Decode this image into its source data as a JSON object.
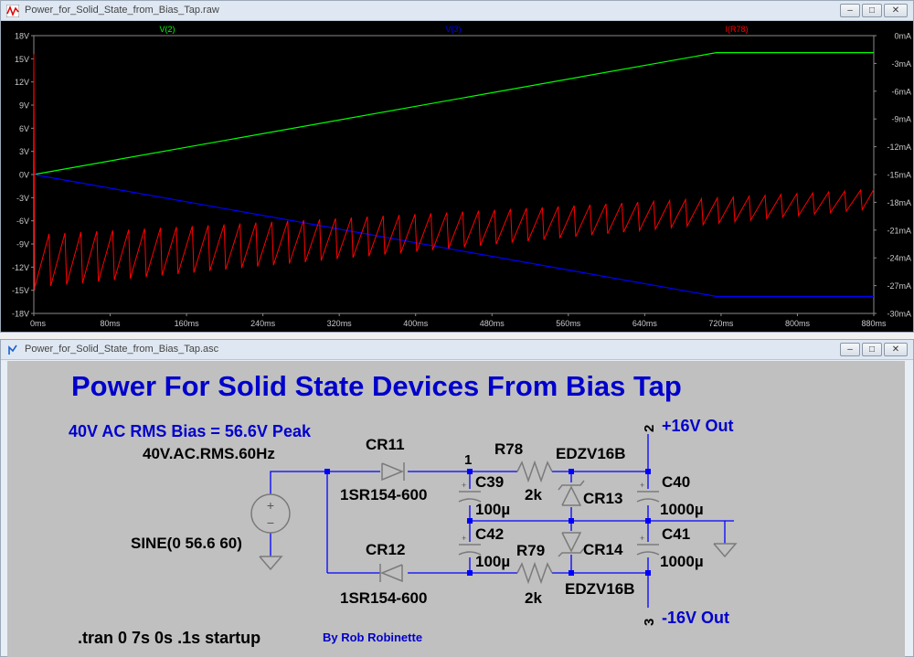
{
  "plot_window": {
    "title": "Power_for_Solid_State_from_Bias_Tap.raw",
    "buttons": [
      "minimize",
      "restore",
      "close"
    ]
  },
  "schematic_window": {
    "title": "Power_for_Solid_State_from_Bias_Tap.asc",
    "buttons": [
      "minimize",
      "restore",
      "close"
    ]
  },
  "chart_data": {
    "type": "line",
    "legend": [
      "V(2)",
      "V(3)",
      "I(R78)"
    ],
    "x_ticks": [
      "0ms",
      "80ms",
      "160ms",
      "240ms",
      "320ms",
      "400ms",
      "480ms",
      "560ms",
      "640ms",
      "720ms",
      "800ms",
      "880ms"
    ],
    "left_ticks": [
      "18V",
      "15V",
      "12V",
      "9V",
      "6V",
      "3V",
      "0V",
      "-3V",
      "-6V",
      "-9V",
      "-12V",
      "-15V",
      "-18V"
    ],
    "right_ticks": [
      "0mA",
      "-3mA",
      "-6mA",
      "-9mA",
      "-12mA",
      "-15mA",
      "-18mA",
      "-21mA",
      "-24mA",
      "-27mA",
      "-30mA"
    ],
    "xlim": [
      0,
      880
    ],
    "ylim_left": [
      -18,
      18
    ],
    "ylim_right": [
      -30,
      0
    ],
    "grid": false,
    "colors": {
      "V(2)": "#00ff00",
      "V(3)": "#0000ff",
      "I(R78)": "#ff0000"
    },
    "series": [
      {
        "name": "V(2)",
        "axis": "left",
        "x": [
          0,
          715,
          880
        ],
        "values": [
          0,
          15.8,
          15.8
        ]
      },
      {
        "name": "V(3)",
        "axis": "left",
        "x": [
          0,
          715,
          880
        ],
        "values": [
          0,
          -15.8,
          -15.8
        ]
      },
      {
        "name": "I(R78)",
        "axis": "right",
        "sawtooth": {
          "period_ms": 16.67,
          "start": [
            -27.2,
            -21.4
          ],
          "end": [
            -18.8,
            -16.6
          ],
          "x_end": 880
        }
      }
    ]
  },
  "schematic": {
    "title": "Power For Solid State Devices From Bias Tap",
    "bias_note": "40V AC RMS Bias = 56.6V Peak",
    "source_label": "40V.AC.RMS.60Hz",
    "source_value": "SINE(0 56.6 60)",
    "directive": ".tran 0 7s 0s .1s startup",
    "author": "By Rob Robinette",
    "parts": {
      "cr11": {
        "ref": "CR11",
        "value": "1SR154-600"
      },
      "cr12": {
        "ref": "CR12",
        "value": "1SR154-600"
      },
      "c39": {
        "ref": "C39",
        "value": "100µ"
      },
      "c42": {
        "ref": "C42",
        "value": "100µ"
      },
      "r78": {
        "ref": "R78",
        "value": "2k"
      },
      "r79": {
        "ref": "R79",
        "value": "2k"
      },
      "cr13": {
        "ref": "CR13",
        "value": "EDZV16B"
      },
      "cr14": {
        "ref": "CR14",
        "value": "EDZV16B"
      },
      "c40": {
        "ref": "C40",
        "value": "1000µ"
      },
      "c41": {
        "ref": "C41",
        "value": "1000µ"
      }
    },
    "nodes": {
      "n1": "1",
      "n2": "2",
      "n3": "3"
    },
    "outputs": {
      "pos": "+16V Out",
      "neg": "-16V Out"
    },
    "colors": {
      "title": "#0000cc",
      "wire": "#0000ff",
      "junction": "#0000ff",
      "text": "#000000",
      "background": "#c0c0c0",
      "component": "#7a7a7a"
    }
  }
}
